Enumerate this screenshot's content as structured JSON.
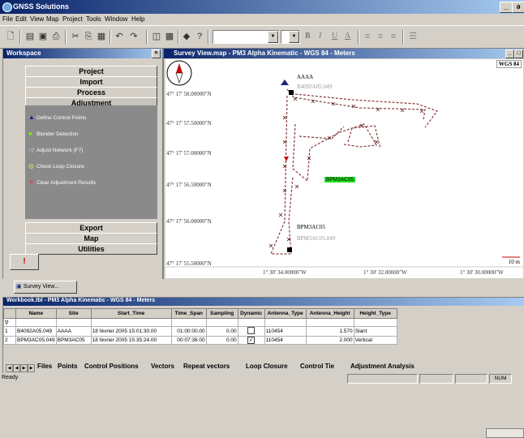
{
  "app": {
    "title": "GNSS Solutions"
  },
  "menu": [
    "File",
    "Edit",
    "View",
    "Map",
    "Project",
    "Tools",
    "Window",
    "Help"
  ],
  "toolbar": {
    "bold": "B",
    "italic": "I",
    "underline": "U",
    "font_color": "A"
  },
  "workspace": {
    "title": "Workspace",
    "buttons": [
      "Project",
      "Import",
      "Process",
      "Adjustment"
    ],
    "items": [
      "Define Control Points",
      "Blunder Detection",
      "Adjust Network (F7)",
      "Check Loop Closure",
      "Clear Adjustment Results"
    ],
    "bottom_buttons": [
      "Export",
      "Map",
      "Utilities"
    ],
    "warn": "!"
  },
  "map": {
    "title": "Survey View.map - PM3 Alpha Kinematic - WGS 84 - Meters",
    "datum": "WGS 84",
    "lat_labels": [
      "47° 17' 58.00000\"N",
      "47° 17' 57.50000\"N",
      "47° 17' 57.00000\"N",
      "47° 17' 56.50000\"N",
      "47° 17' 56.00000\"N",
      "47° 17' 55.50000\"N"
    ],
    "lon_labels": [
      "1° 30' 34.00000\"W",
      "1° 30' 32.00000\"W",
      "1° 30' 30.00000\"W"
    ],
    "points": {
      "p1": "AAAA",
      "p1_file": "B4092A05.049",
      "p2": "BPM3AC05",
      "p2_file": "BPM3AC05.049",
      "highlight": "BPM3AC05"
    },
    "scale": "10 m"
  },
  "view_tab": "Survey View...",
  "workbook": {
    "title": "Workbook.tbl - PM3 Alpha Kinematic - WGS 84 - Meters",
    "columns": [
      "Name",
      "Site",
      "Start_Time",
      "Time_Span",
      "Sampling",
      "Dynamic",
      "Antenna_Type",
      "Antenna_Height",
      "Height_Type"
    ],
    "filter_icon": "∇",
    "rows": [
      {
        "idx": "1",
        "name": "B4092A05.049",
        "site": "AAAA",
        "start": "18 février 2005 15:01:30.00",
        "span": "01:00:00.00",
        "sampling": "0.00",
        "dynamic": "",
        "antenna": "110454",
        "height": "1.570",
        "htype": "Slant"
      },
      {
        "idx": "2",
        "name": "BPM3AC05.049",
        "site": "BPM3AC05",
        "start": "18 février 2005 15:35:24.00",
        "span": "00:07:38.00",
        "sampling": "0.00",
        "dynamic": "✓",
        "antenna": "110454",
        "height": "2.000",
        "htype": "Vertical"
      }
    ],
    "sheet_tabs": [
      "Files",
      "Points",
      "Control Positions",
      "Vectors",
      "Repeat vectors",
      "Loop Closure",
      "Control Tie",
      "Adjustment Analysis"
    ]
  },
  "status": {
    "text": "Ready",
    "num": "NUM"
  }
}
